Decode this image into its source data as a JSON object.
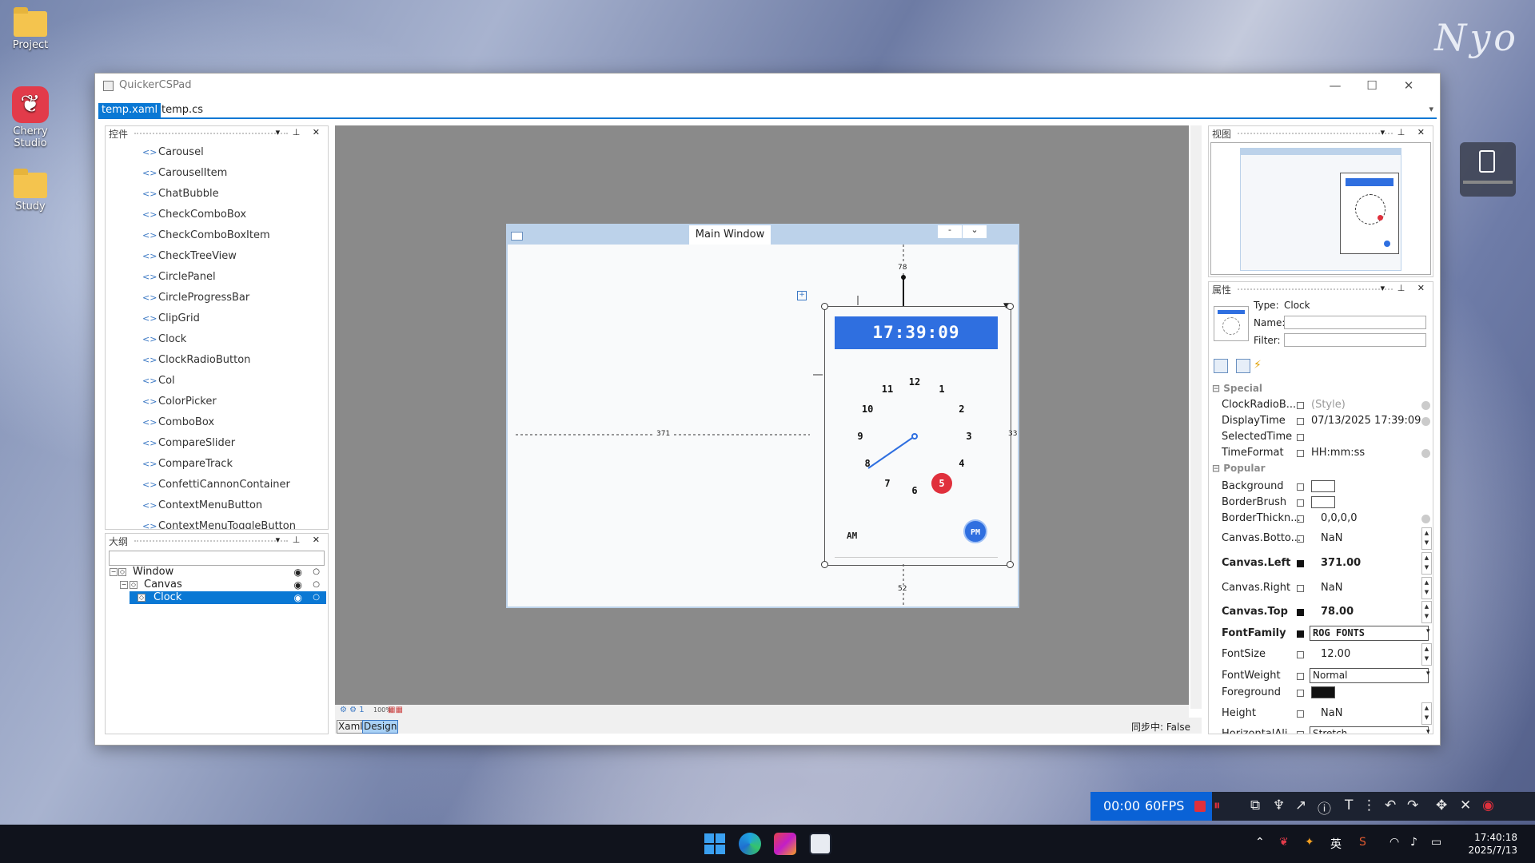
{
  "desktop": {
    "icons": [
      {
        "label": "Project"
      },
      {
        "label": "Cherry Studio"
      },
      {
        "label": "Study"
      }
    ],
    "signature": "Nyo"
  },
  "window": {
    "title": "QuickerCSPad",
    "tabs": [
      "temp.xaml",
      "temp.cs"
    ],
    "controls": {
      "minimize": "—",
      "maximize": "☐",
      "close": "✕"
    }
  },
  "toolbox": {
    "title": "控件",
    "buttons": "▾ ⊥ ✕",
    "items": [
      "Carousel",
      "CarouselItem",
      "ChatBubble",
      "CheckComboBox",
      "CheckComboBoxItem",
      "CheckTreeView",
      "CirclePanel",
      "CircleProgressBar",
      "ClipGrid",
      "Clock",
      "ClockRadioButton",
      "Col",
      "ColorPicker",
      "ComboBox",
      "CompareSlider",
      "CompareTrack",
      "ConfettiCannonContainer",
      "ContextMenuButton",
      "ContextMenuToggleButton"
    ]
  },
  "outline": {
    "title": "大纲",
    "rows": [
      {
        "label": "Window"
      },
      {
        "label": "Canvas"
      },
      {
        "label": "Clock"
      }
    ]
  },
  "designer": {
    "window_title": "Main Window",
    "clock": {
      "digital_time": "17:39:09",
      "numbers": [
        "12",
        "1",
        "2",
        "3",
        "4",
        "5",
        "6",
        "7",
        "8",
        "9",
        "10",
        "11"
      ],
      "am_label": "AM",
      "pm_label": "PM",
      "highlight_number": "5",
      "colors": {
        "digital_bg": "#2f6fe0",
        "highlight": "#e0303c",
        "hand": "#2f6fe0"
      }
    },
    "dims": {
      "left": "371",
      "top": "78",
      "right": "33",
      "bottom": "52"
    },
    "view_tabs": [
      "Xaml",
      "Design"
    ],
    "zoom": "100%",
    "status_label": "同步中:",
    "status_value": "False"
  },
  "view_panel": {
    "title": "视图"
  },
  "properties": {
    "title": "属性",
    "type_label": "Type:",
    "type_value": "Clock",
    "name_label": "Name:",
    "filter_label": "Filter:",
    "categories": [
      "Special",
      "Popular"
    ],
    "special_rows": [
      {
        "name": "ClockRadioB...",
        "value": "(Style)"
      },
      {
        "name": "DisplayTime",
        "value": "07/13/2025 17:39:09"
      },
      {
        "name": "SelectedTime",
        "value": ""
      },
      {
        "name": "TimeFormat",
        "value": "HH:mm:ss"
      }
    ],
    "popular_rows": [
      {
        "name": "Background",
        "value": ""
      },
      {
        "name": "BorderBrush",
        "value": ""
      },
      {
        "name": "BorderThickn...",
        "value": "0,0,0,0"
      },
      {
        "name": "Canvas.Botto...",
        "value": "NaN"
      },
      {
        "name": "Canvas.Left",
        "value": "371.00"
      },
      {
        "name": "Canvas.Right",
        "value": "NaN"
      },
      {
        "name": "Canvas.Top",
        "value": "78.00"
      },
      {
        "name": "FontFamily",
        "value": "ROG FONTS"
      },
      {
        "name": "FontSize",
        "value": "12.00"
      },
      {
        "name": "FontWeight",
        "value": "Normal"
      },
      {
        "name": "Foreground",
        "value": ""
      },
      {
        "name": "Height",
        "value": "NaN"
      },
      {
        "name": "HorizontalAli...",
        "value": "Stretch"
      }
    ]
  },
  "recorder": {
    "time": "00:00",
    "fps": "60FPS"
  },
  "taskbar": {
    "time": "17:40:18",
    "date": "2025/7/13",
    "ime": "英"
  }
}
